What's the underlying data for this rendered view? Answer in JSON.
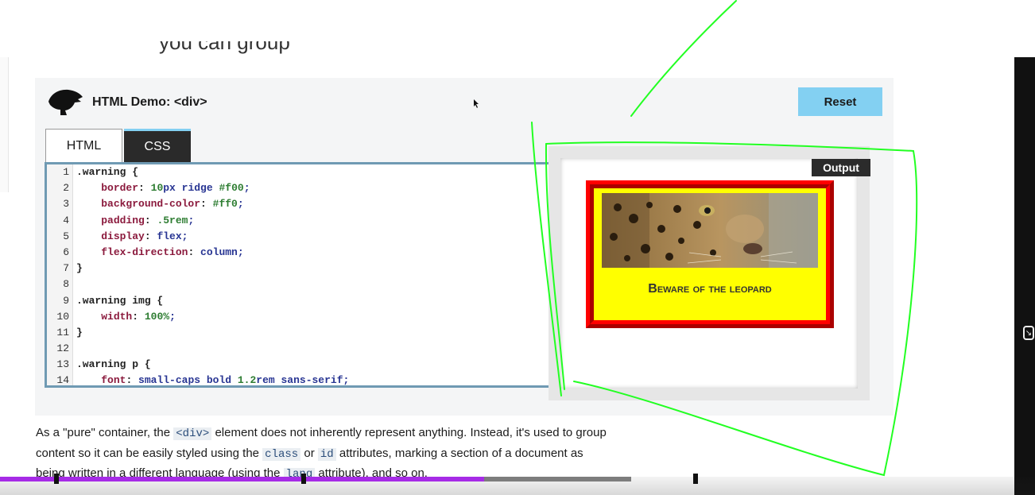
{
  "heading_fragment": "you can group",
  "demo": {
    "title": "HTML Demo: <div>",
    "reset_label": "Reset",
    "tabs": [
      {
        "label": "HTML",
        "active": false
      },
      {
        "label": "CSS",
        "active": true
      }
    ],
    "code_lines": [
      {
        "n": "1",
        "text": ".warning {"
      },
      {
        "n": "2",
        "text": "    border: 10px ridge #f00;"
      },
      {
        "n": "3",
        "text": "    background-color: #ff0;"
      },
      {
        "n": "4",
        "text": "    padding: .5rem;"
      },
      {
        "n": "5",
        "text": "    display: flex;"
      },
      {
        "n": "6",
        "text": "    flex-direction: column;"
      },
      {
        "n": "7",
        "text": "}"
      },
      {
        "n": "8",
        "text": ""
      },
      {
        "n": "9",
        "text": ".warning img {"
      },
      {
        "n": "10",
        "text": "    width: 100%;"
      },
      {
        "n": "11",
        "text": "}"
      },
      {
        "n": "12",
        "text": ""
      },
      {
        "n": "13",
        "text": ".warning p {"
      },
      {
        "n": "14",
        "text": "    font: small-caps bold 1.2rem sans-serif;"
      }
    ],
    "output_label": "Output",
    "warning_text": "Beware of the leopard"
  },
  "description": {
    "p1": "As a \"pure\" container, the ",
    "c1": "<div>",
    "p2": " element does not inherently represent anything. Instead, it's used to group content so it can be easily styled using the ",
    "c2": "class",
    "p3": " or ",
    "c3": "id",
    "p4": " attributes, marking a section of a document as being written in a different language (using the ",
    "c4": "lang",
    "p5": " attribute), and so on."
  },
  "video": {
    "played_fraction": 0.468,
    "buffered_fraction": 0.61
  },
  "colors": {
    "accent": "#83d0f2",
    "annotation": "#22ff22",
    "progress": "#a62be6",
    "warning_border": "#f00",
    "warning_bg": "#ff0"
  },
  "icons": [
    "dino-logo-icon",
    "mouse-cursor-icon",
    "exit-fullscreen-icon"
  ]
}
